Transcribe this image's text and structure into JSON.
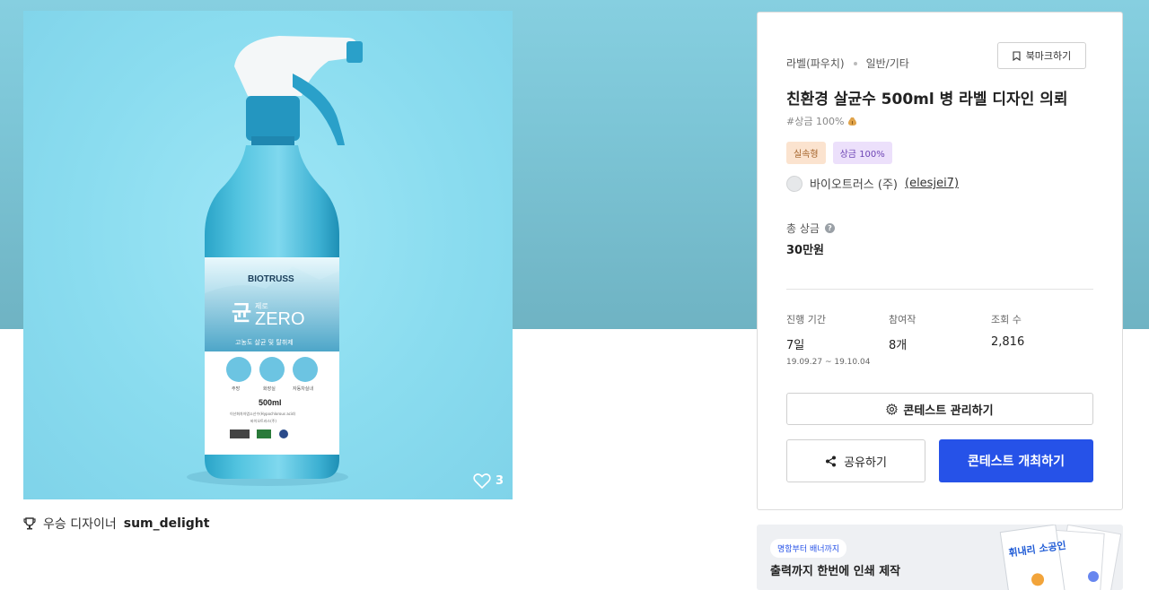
{
  "product": {
    "likes": "3",
    "winner_prefix": "우승 디자이너",
    "winner_name": "sum_delight",
    "label_brand": "BIOTRUSS",
    "label_kor": "균",
    "label_kor_small": "제로",
    "label_en": "ZERO",
    "label_sub": "고농도 살균 및 탈취제",
    "label_volume": "500ml",
    "label_line1": "이산화차아염소산수(Hypochlorous acid)",
    "label_line2": "바이오트러스(주)",
    "label_icon1": "주방",
    "label_icon2": "화장실",
    "label_icon3": "자동차실내"
  },
  "contest": {
    "category_main": "라벨(파우치)",
    "category_sub": "일반/기타",
    "bookmark_label": "북마크하기",
    "title": "친환경 살균수 500ml 병 라벨 디자인 의뢰",
    "prize_hashtag": "#상금 100%",
    "tags": [
      "실속형",
      "상금 100%"
    ],
    "host_name": "바이오트러스 (주)",
    "host_id": "(elesjei7)",
    "total_prize_label": "총 상금",
    "total_prize_value": "30만원",
    "stats": {
      "period_label": "진행 기간",
      "period_value": "7일",
      "period_range": "19.09.27 ~ 19.10.04",
      "participants_label": "참여작",
      "participants_value": "8개",
      "views_label": "조회 수",
      "views_value": "2,816"
    },
    "manage_label": "콘테스트 관리하기",
    "share_label": "공유하기",
    "open_label": "콘테스트 개최하기"
  },
  "banner": {
    "pill": "명함부터 배너까지",
    "text": "출력까지 한번에 인쇄 제작",
    "art_text": "휘내리 소공인"
  },
  "colors": {
    "primary": "#2652e8",
    "hero_bg": "#7cc5d6",
    "product_bg": "#8adcef"
  }
}
